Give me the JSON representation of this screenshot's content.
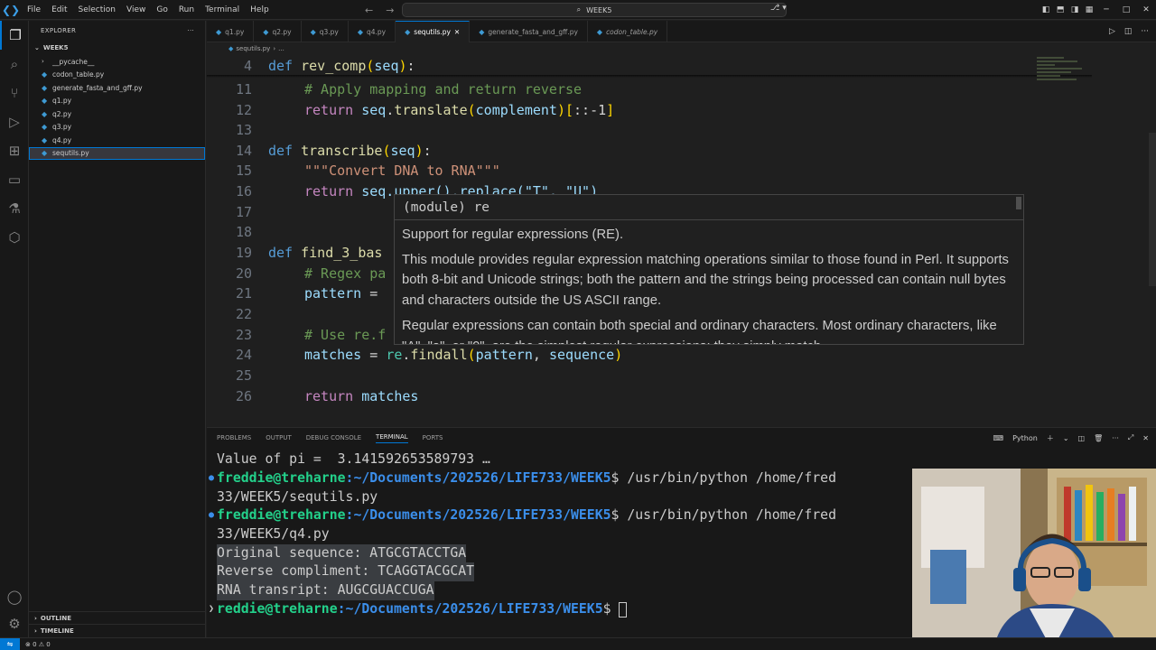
{
  "titlebar": {
    "menu": [
      "File",
      "Edit",
      "Selection",
      "View",
      "Go",
      "Run",
      "Terminal",
      "Help"
    ],
    "search": "WEEK5"
  },
  "sidebar": {
    "header": "EXPLORER",
    "folder": "WEEK5",
    "items": [
      {
        "label": "__pycache__",
        "type": "folder"
      },
      {
        "label": "codon_table.py",
        "type": "py"
      },
      {
        "label": "generate_fasta_and_gff.py",
        "type": "py"
      },
      {
        "label": "q1.py",
        "type": "py"
      },
      {
        "label": "q2.py",
        "type": "py"
      },
      {
        "label": "q3.py",
        "type": "py"
      },
      {
        "label": "q4.py",
        "type": "py"
      },
      {
        "label": "sequtils.py",
        "type": "py",
        "selected": true
      }
    ],
    "outline": "OUTLINE",
    "timeline": "TIMELINE"
  },
  "tabs": [
    {
      "label": "q1.py"
    },
    {
      "label": "q2.py"
    },
    {
      "label": "q3.py"
    },
    {
      "label": "q4.py"
    },
    {
      "label": "sequtils.py",
      "active": true
    },
    {
      "label": "generate_fasta_and_gff.py"
    },
    {
      "label": "codon_table.py",
      "italic": true
    }
  ],
  "breadcrumb": {
    "file": "sequtils.py",
    "rest": "..."
  },
  "editor": {
    "lines": [
      {
        "n": "4"
      },
      {
        "n": "11"
      },
      {
        "n": "12"
      },
      {
        "n": "13"
      },
      {
        "n": "14"
      },
      {
        "n": "15"
      },
      {
        "n": "16"
      },
      {
        "n": "17"
      },
      {
        "n": "18"
      },
      {
        "n": "19"
      },
      {
        "n": "20"
      },
      {
        "n": "21"
      },
      {
        "n": "22"
      },
      {
        "n": "23"
      },
      {
        "n": "24"
      },
      {
        "n": "25"
      },
      {
        "n": "26"
      }
    ],
    "tokens": {
      "def": "def",
      "return": "return",
      "rev_comp": "rev_comp",
      "seq": "seq",
      "c11": "# Apply mapping and return reverse",
      "translate": "translate",
      "complement": "complement",
      "slice": "::-1",
      "transcribe": "transcribe",
      "doc15": "\"\"\"Convert DNA to RNA\"\"\"",
      "l16": "seq.upper().replace(\"T\", \"U\")",
      "find3": "find_3_bas",
      "c20": "# Regex pa",
      "pattern": "pattern",
      "eq": " =",
      "c23": "# Use re.f",
      "matches": "matches",
      "re": "re",
      "findall": "findall",
      "sequence": "sequence"
    }
  },
  "hover": {
    "signature": "(module) re",
    "p1": "Support for regular expressions (RE).",
    "p2": "This module provides regular expression matching operations similar to those found in Perl. It supports both 8-bit and Unicode strings; both the pattern and the strings being processed can contain null bytes and characters outside the US ASCII range.",
    "p3": "Regular expressions can contain both special and ordinary characters. Most ordinary characters, like \"A\", \"a\", or \"0\", are the simplest regular expressions; they simply match"
  },
  "panel": {
    "tabs": [
      "PROBLEMS",
      "OUTPUT",
      "DEBUG CONSOLE",
      "TERMINAL",
      "PORTS"
    ],
    "active_tab": "TERMINAL",
    "shell": "Python"
  },
  "terminal": {
    "pi_line": "Value of pi =  3.141592653589793 …",
    "prompt_user": "freddie@treharne",
    "prompt_user_cut": "reddie@treharne",
    "prompt_path": ":~/Documents/202526/LIFE733/WEEK5",
    "prompt_sign": "$ ",
    "cmd1": "/usr/bin/python /home/fred",
    "wrap1": "33/WEEK5/sequtils.py",
    "cmd2": "/usr/bin/python /home/fred",
    "wrap2": "33/WEEK5/q4.py",
    "out1": "Original sequence: ATGCGTACCTGA",
    "out2": "Reverse compliment: TCAGGTACGCAT",
    "out3": "RNA transript: AUGCGUACCUGA"
  },
  "statusbar": {
    "problems": "⊗ 0 ⚠ 0"
  },
  "colors": {
    "accent": "#0078d4",
    "terminal_user": "#23d18b",
    "terminal_path": "#3b8eea"
  }
}
